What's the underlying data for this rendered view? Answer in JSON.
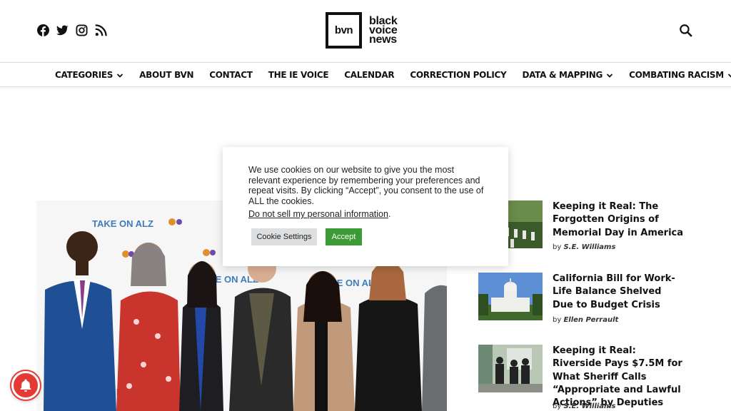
{
  "header": {
    "social": [
      {
        "icon": "facebook-icon"
      },
      {
        "icon": "twitter-icon"
      },
      {
        "icon": "instagram-icon"
      },
      {
        "icon": "rss-icon"
      }
    ],
    "logo": {
      "mark": "bvn",
      "line1": "black",
      "line2": "voice",
      "line3": "news"
    },
    "search_icon": "search-icon"
  },
  "nav": {
    "items": [
      {
        "label": "CATEGORIES",
        "dropdown": true
      },
      {
        "label": "ABOUT BVN",
        "dropdown": false
      },
      {
        "label": "CONTACT",
        "dropdown": false
      },
      {
        "label": "THE IE VOICE",
        "dropdown": false
      },
      {
        "label": "CALENDAR",
        "dropdown": false
      },
      {
        "label": "CORRECTION POLICY",
        "dropdown": false
      },
      {
        "label": "DATA & MAPPING",
        "dropdown": true
      },
      {
        "label": "COMBATING RACISM",
        "dropdown": true
      }
    ]
  },
  "hero": {
    "backdrop_text": "TAKE ON ALZ"
  },
  "sidebar": {
    "stories": [
      {
        "title": "Keeping it Real: The Forgotten Origins of Memorial Day in America",
        "by": "by",
        "author": "S.E. Williams"
      },
      {
        "title": "California Bill for Work-Life Balance Shelved Due to Budget Crisis",
        "by": "by",
        "author": "Ellen Perrault"
      },
      {
        "title": "Keeping it Real: Riverside Pays $7.5M for What Sheriff Calls  “Appropriate and Lawful Actions” by Deputies",
        "by": "by",
        "author": "S.E. Williams"
      }
    ]
  },
  "cookie": {
    "text": "We use cookies on our website to give you the most relevant experience by remembering your preferences and repeat visits. By clicking “Accept”, you consent to the use of ALL the cookies.",
    "link": "Do not sell my personal information",
    "link_suffix": ".",
    "settings_label": "Cookie Settings",
    "accept_label": "Accept"
  },
  "notification": {
    "icon": "bell-icon"
  },
  "colors": {
    "accept": "#3d9b35",
    "bell": "#e53935",
    "text": "#111111"
  }
}
